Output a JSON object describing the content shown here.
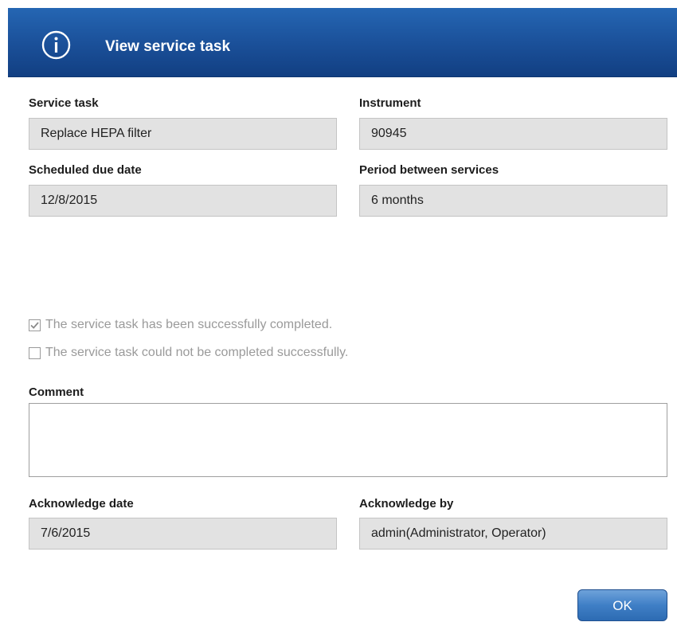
{
  "dialog": {
    "title": "View service task",
    "icon": "info-icon",
    "header_color": "#1a4f98"
  },
  "fields": {
    "service_task": {
      "label": "Service task",
      "value": "Replace HEPA filter"
    },
    "instrument": {
      "label": "Instrument",
      "value": "90945"
    },
    "scheduled_due_date": {
      "label": "Scheduled due date",
      "value": "12/8/2015"
    },
    "period_between_services": {
      "label": "Period between services",
      "value": "6 months"
    },
    "acknowledge_date": {
      "label": "Acknowledge date",
      "value": "7/6/2015"
    },
    "acknowledge_by": {
      "label": "Acknowledge by",
      "value": "admin(Administrator, Operator)"
    }
  },
  "options": {
    "completed": {
      "label": "The service task has been successfully completed.",
      "checked": true
    },
    "not_completed": {
      "label": "The service task could not be completed successfully.",
      "checked": false
    }
  },
  "comment": {
    "label": "Comment",
    "value": ""
  },
  "buttons": {
    "ok_label": "OK"
  }
}
